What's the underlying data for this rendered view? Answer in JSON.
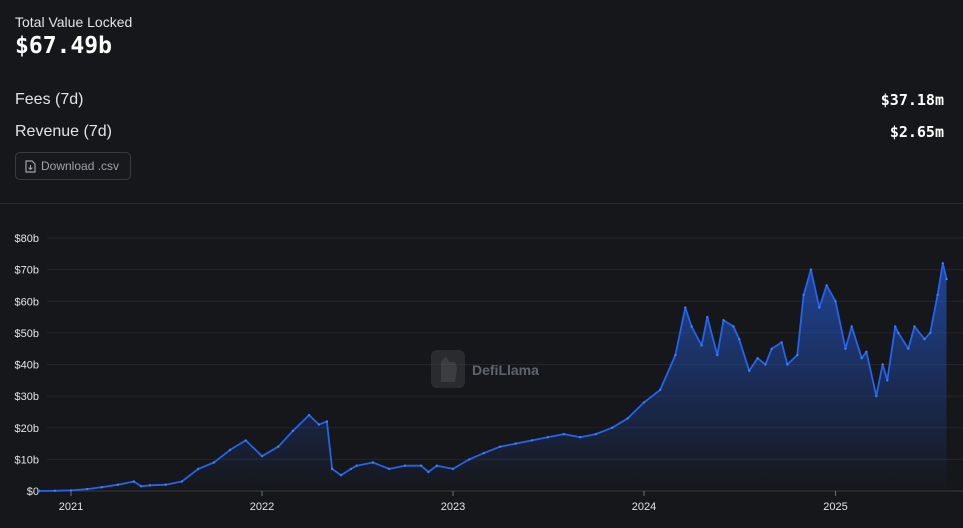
{
  "summary": {
    "tvl_label": "Total Value Locked",
    "tvl_value": "$67.49b",
    "fees_label": "Fees (7d)",
    "fees_value": "$37.18m",
    "revenue_label": "Revenue (7d)",
    "revenue_value": "$2.65m",
    "download_label": "Download .csv"
  },
  "watermark": {
    "text": "DefiLlama"
  },
  "chart_data": {
    "type": "area",
    "title": "",
    "xlabel": "",
    "ylabel": "",
    "x_ticks": [
      "2021",
      "2022",
      "2023",
      "2024",
      "2025"
    ],
    "y_ticks": [
      "$0",
      "$10b",
      "$20b",
      "$30b",
      "$40b",
      "$50b",
      "$60b",
      "$70b",
      "$80b"
    ],
    "ylim": [
      0,
      80
    ],
    "grid": "horizontal",
    "legend": "none",
    "line_color": "#2563eb",
    "series": [
      {
        "x": [
          "2020-11-01",
          "2020-12-01",
          "2021-01-01",
          "2021-02-01",
          "2021-03-01",
          "2021-04-01",
          "2021-05-01",
          "2021-05-15",
          "2021-06-01",
          "2021-07-01",
          "2021-08-01",
          "2021-09-01",
          "2021-10-01",
          "2021-11-01",
          "2021-12-01",
          "2022-01-01",
          "2022-02-01",
          "2022-03-01",
          "2022-04-01",
          "2022-04-20",
          "2022-05-05",
          "2022-05-15",
          "2022-06-01",
          "2022-06-20",
          "2022-07-01",
          "2022-08-01",
          "2022-09-01",
          "2022-10-01",
          "2022-11-01",
          "2022-11-15",
          "2022-12-01",
          "2023-01-01",
          "2023-02-01",
          "2023-03-01",
          "2023-04-01",
          "2023-05-01",
          "2023-06-01",
          "2023-07-01",
          "2023-08-01",
          "2023-09-01",
          "2023-10-01",
          "2023-11-01",
          "2023-12-01",
          "2024-01-01",
          "2024-02-01",
          "2024-03-01",
          "2024-03-20",
          "2024-04-01",
          "2024-04-20",
          "2024-05-01",
          "2024-05-20",
          "2024-06-01",
          "2024-06-20",
          "2024-07-01",
          "2024-07-20",
          "2024-08-05",
          "2024-08-20",
          "2024-09-01",
          "2024-09-20",
          "2024-10-01",
          "2024-10-20",
          "2024-11-01",
          "2024-11-15",
          "2024-12-01",
          "2024-12-15",
          "2025-01-01",
          "2025-01-20",
          "2025-02-01",
          "2025-02-20",
          "2025-03-01",
          "2025-03-20",
          "2025-04-01",
          "2025-04-10",
          "2025-04-25",
          "2025-05-01",
          "2025-05-20",
          "2025-06-01",
          "2025-06-20",
          "2025-07-01",
          "2025-07-15",
          "2025-07-25",
          "2025-08-01"
        ],
        "values": [
          0,
          0.05,
          0.2,
          0.6,
          1.2,
          2,
          3,
          1.5,
          1.8,
          2,
          3,
          7,
          9,
          13,
          16,
          11,
          14,
          19,
          24,
          21,
          22,
          7,
          5,
          7,
          8,
          9,
          7,
          8,
          8,
          6,
          8,
          7,
          10,
          12,
          14,
          15,
          16,
          17,
          18,
          17,
          18,
          20,
          23,
          28,
          32,
          43,
          58,
          52,
          46,
          55,
          43,
          54,
          52,
          48,
          38,
          42,
          40,
          45,
          47,
          40,
          43,
          62,
          70,
          58,
          65,
          60,
          45,
          52,
          42,
          44,
          30,
          40,
          35,
          52,
          50,
          45,
          52,
          48,
          50,
          62,
          72,
          67
        ]
      }
    ]
  }
}
